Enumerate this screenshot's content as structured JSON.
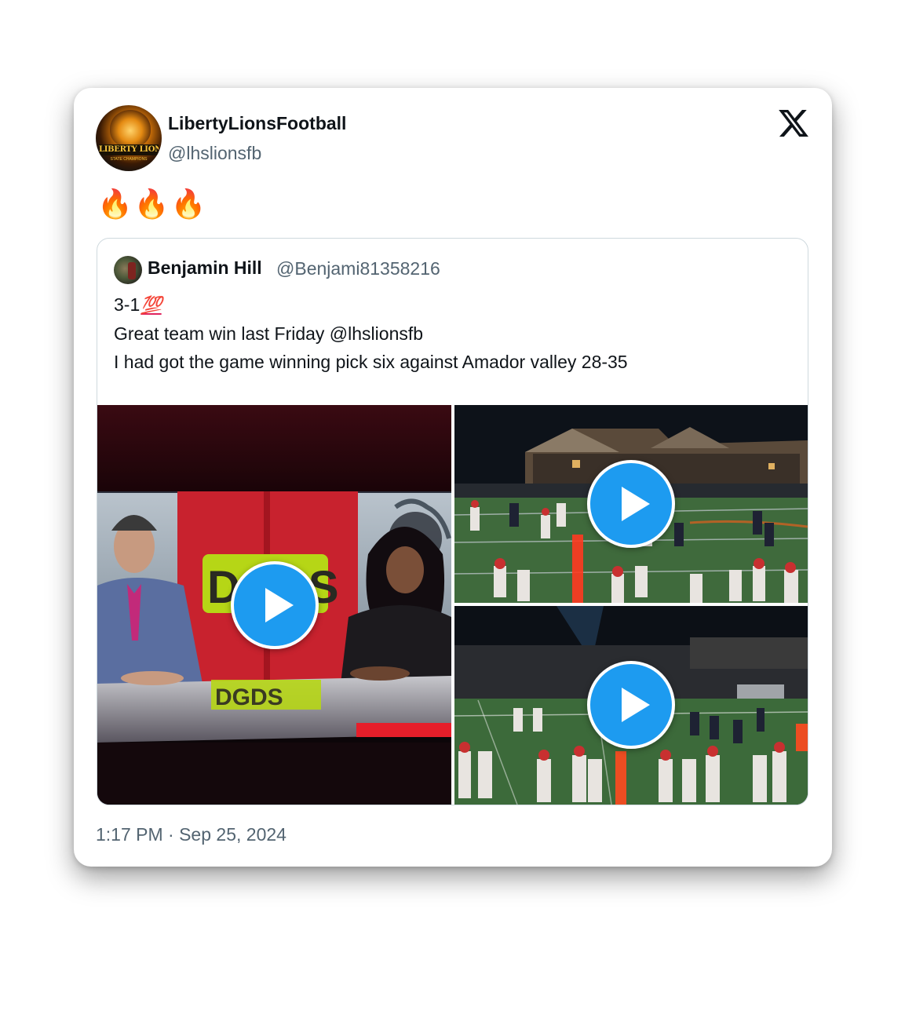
{
  "author": {
    "display_name": "LibertyLionsFootball",
    "handle": "@lhslionsfb",
    "avatar_text": "LIBERTY LIONS",
    "avatar_subtext": "STATE CHAMPIONS"
  },
  "tweet": {
    "text": "🔥🔥🔥"
  },
  "quoted_tweet": {
    "display_name": "Benjamin Hill",
    "handle": "@Benjami81358216",
    "line1": "3-1",
    "line1_emoji": "💯",
    "line2": "Great team win last Friday @lhslionsfb",
    "line3": "I had got the game winning pick six against Amador valley 28-35",
    "media": [
      {
        "type": "video",
        "icon": "play-icon"
      },
      {
        "type": "video",
        "icon": "play-icon"
      },
      {
        "type": "video",
        "icon": "play-icon"
      }
    ]
  },
  "timestamp": "1:17 PM · Sep 25, 2024",
  "icons": {
    "x_logo": "x-logo-icon"
  },
  "colors": {
    "accent": "#1d9bf0",
    "secondary_text": "#536471",
    "primary_text": "#0f1419",
    "border": "#cfd9de"
  }
}
